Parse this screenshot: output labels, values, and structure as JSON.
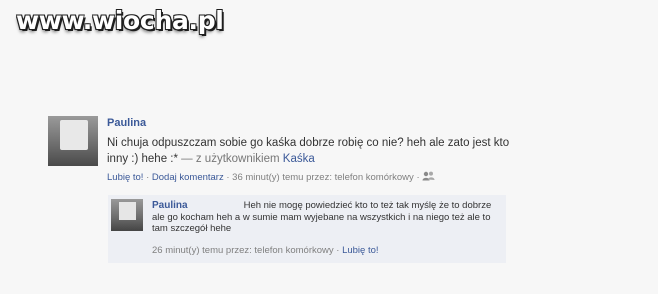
{
  "watermark": {
    "text": "www.wiocha.pl"
  },
  "post": {
    "author": "Paulina",
    "text": "Ni chuja odpuszczam sobie go kaśka dobrze robię co nie? heh ale zato jest kto inny :) hehe :*",
    "via_prefix": "— z użytkownikiem",
    "via_user": "Kaśka",
    "like_label": "Lubię to!",
    "sep": "·",
    "comment_label": "Dodaj komentarz",
    "time_text": "36 minut(y) temu przez: telefon komórkowy",
    "privacy_icon": "people-icon"
  },
  "comment": {
    "author": "Paulina",
    "text_first": "Heh nie mogę powiedzieć kto to też tak myślę że",
    "text_rest": "to dobrze ale go kocham heh a w sumie mam wyjebane na wszystkich i na niego też ale to tam szczegół hehe",
    "time_text": "26 minut(y) temu przez: telefon komórkowy",
    "sep": "·",
    "like_label": "Lubię to!"
  }
}
